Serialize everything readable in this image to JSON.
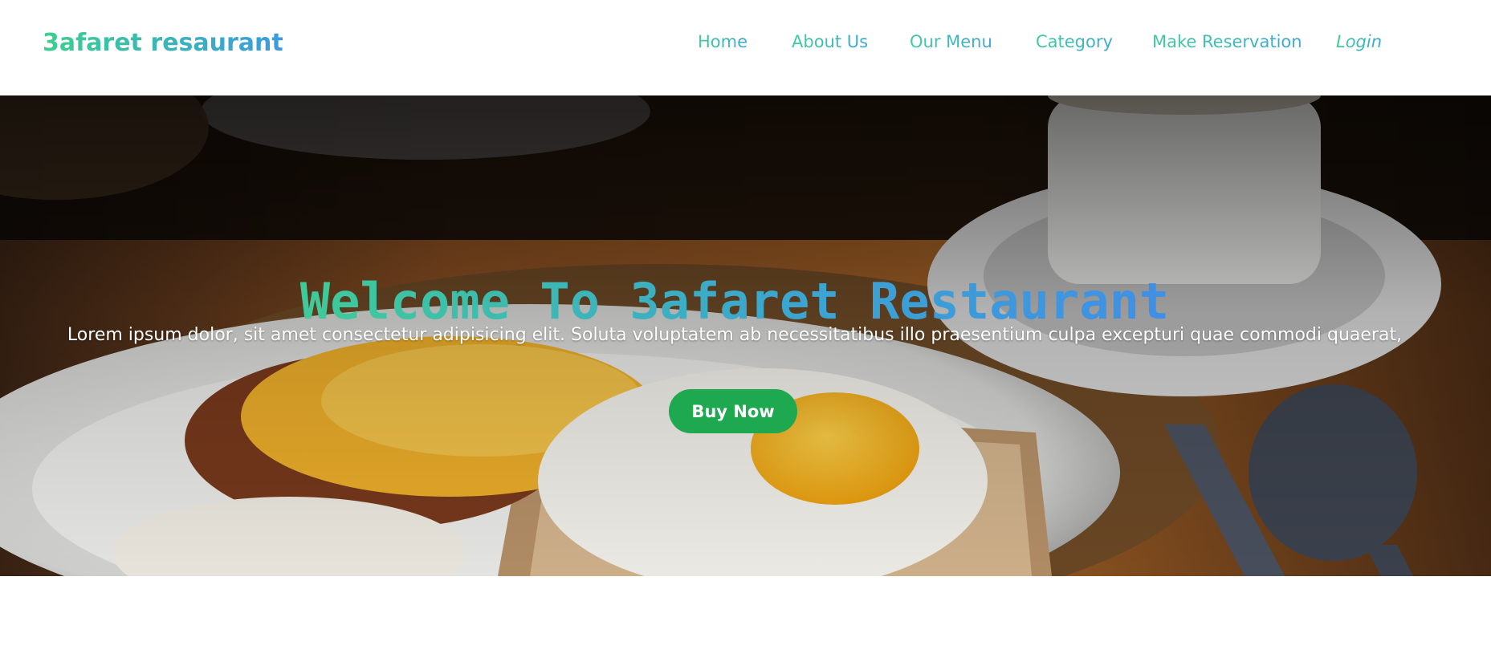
{
  "brand": {
    "name": "3afaret resaurant"
  },
  "nav": {
    "items": [
      {
        "label": "Home"
      },
      {
        "label": "About Us"
      },
      {
        "label": "Our Menu"
      },
      {
        "label": "Category"
      },
      {
        "label": "Make Reservation"
      },
      {
        "label": "Login"
      }
    ]
  },
  "hero": {
    "title": "Welcome To 3afaret Restaurant",
    "subtitle": "Lorem ipsum dolor, sit amet consectetur adipisicing elit. Soluta voluptatem ab necessitatibus illo praesentium culpa excepturi quae commodi quaerat,",
    "cta_label": "Buy Now",
    "image": "breakfast-plate-photo"
  },
  "colors": {
    "brand_gradient_start": "#3ecf8e",
    "brand_gradient_end": "#3a9be0",
    "cta": "#1ea84f"
  }
}
